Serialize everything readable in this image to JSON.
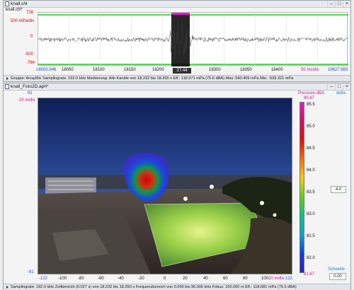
{
  "window_top": {
    "title": "knall.chl",
    "tab": "knall.chl*",
    "y_ticks": [
      "728",
      "500 mPa/div",
      "0",
      "-500",
      "-764"
    ],
    "x_ticks": [
      "18000.946",
      "18050",
      "18100",
      "18150",
      "18200",
      "18300",
      "18350",
      "18400",
      "18627.883"
    ],
    "marker_value": "27.44",
    "x_scale": "50 ms/div",
    "status": "Gruppe: ArrayMic  Samplingrate: 192.0 kHz  Markierung: Alle Kanäle von 18.232 bis 18.265 s  Eff.: 118.671 mPa (75.5 dBA)  Max: 540.409 mPa  Min: -539.321 mPa"
  },
  "window_bottom": {
    "title": "knall_Foto2D.aph*",
    "y_ticks": [
      "91",
      "20 m/div",
      "-91"
    ],
    "x_ticks": [
      "-122",
      "-100",
      "-80",
      "-60",
      "-40",
      "-20",
      "0",
      "20",
      "40",
      "60",
      "80",
      "100",
      "20 m/div",
      "122"
    ],
    "status": "Samplingrate: 192.0 kHz  Zeitbereich (0.027 s) von 18.232 bis 18.260 s  Frequenzbereich von 0.000 bis 96.000 kHz  Fokus: 100.000 m  Eff.: 118.681 mPa (75.5 dBA)"
  },
  "colorbar": {
    "title": "Pressure dBA",
    "top_value": "85.67",
    "bottom_value": "81.67",
    "ticks": [
      "85.5",
      "85.0",
      "84.5",
      "84.0",
      "83.5",
      "83.0",
      "82.5",
      "82.0"
    ],
    "delta_label": "delta",
    "delta_value": "4.0",
    "threshold_label": "Schwelle",
    "threshold_value": "0.00"
  },
  "colors": {
    "waveform": "#3a3a3a",
    "marker": "#e01ad0",
    "limit_lines": "#22c322"
  }
}
